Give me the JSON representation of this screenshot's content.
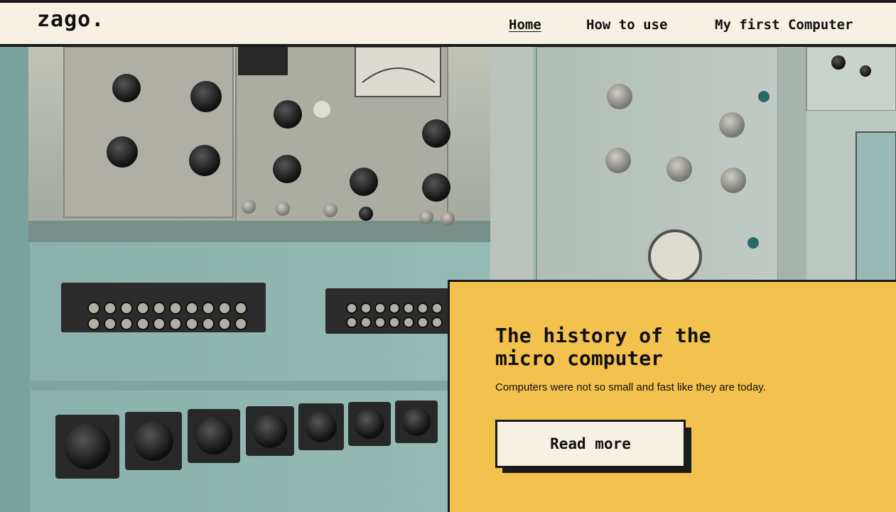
{
  "brand": {
    "logo": "zago."
  },
  "nav": {
    "items": [
      {
        "label": "Home",
        "active": true
      },
      {
        "label": "How to use",
        "active": false
      },
      {
        "label": "My first Computer",
        "active": false
      }
    ]
  },
  "hero": {
    "image": "vintage-computer-control-panel-photo",
    "card": {
      "title": "The history of the micro computer",
      "subtitle": "Computers were not so small and fast like they are today.",
      "cta_label": "Read more"
    }
  },
  "colors": {
    "background": "#f7f1e4",
    "card": "#f2c14e",
    "ink": "#1a1a1a",
    "panel_teal": "#9ec3bd"
  }
}
